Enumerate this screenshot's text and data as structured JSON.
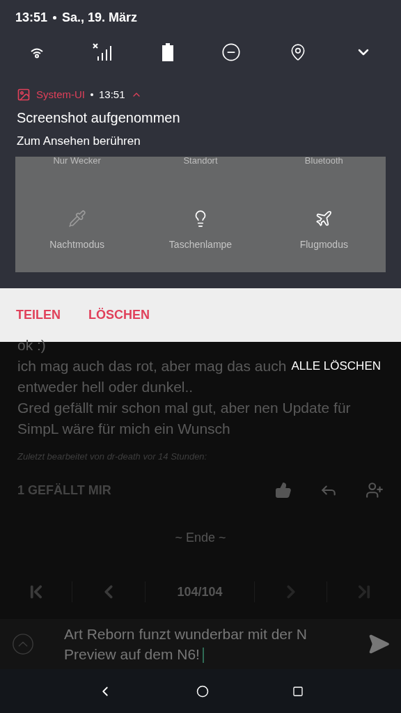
{
  "status": {
    "time": "13:51",
    "date": "Sa., 19. März"
  },
  "notification": {
    "app": "System-UI",
    "time": "13:51",
    "expanded": true,
    "title": "Screenshot aufgenommen",
    "text": "Zum Ansehen berühren",
    "actions": [
      "TEILEN",
      "LÖSCHEN"
    ]
  },
  "tiles_top": [
    "Nur Wecker",
    "Standort",
    "Bluetooth"
  ],
  "tiles": [
    {
      "kind": "night",
      "label": "Nachtmodus",
      "on": false
    },
    {
      "kind": "flashlight",
      "label": "Taschenlampe",
      "on": true
    },
    {
      "kind": "airplane",
      "label": "Flugmodus",
      "on": true
    }
  ],
  "clear_all": "ALLE LÖSCHEN",
  "post": {
    "lines": [
      "ok :)",
      "ich mag auch das rot, aber mag das auch",
      "entweder hell oder dunkel..",
      "Gred gefällt mir schon mal gut, aber nen Update für SimpL wäre für mich ein Wunsch"
    ],
    "edited": "Zuletzt bearbeitet von dr-death vor 14 Stunden:",
    "likes": "1 GEFÄLLT MIR"
  },
  "end": "~ Ende ~",
  "pager": {
    "page": "104/104"
  },
  "composer": {
    "value": "Art Reborn funzt wunderbar mit der N Preview auf dem N6!"
  }
}
